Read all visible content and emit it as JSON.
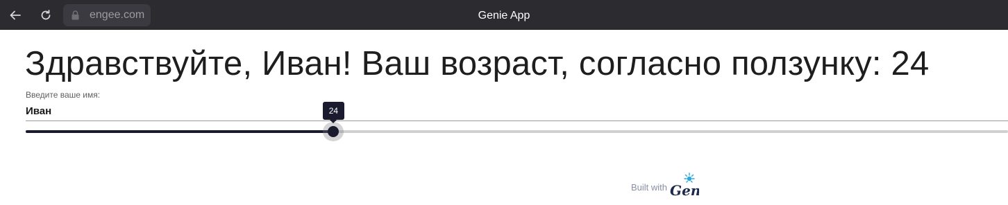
{
  "browser": {
    "url": "engee.com",
    "title": "Genie App",
    "icons": [
      "back-arrow-icon",
      "reload-icon",
      "lock-icon"
    ]
  },
  "main": {
    "heading": "Здравствуйте, Иван! Ваш возраст, согласно ползунку: 24",
    "name_label": "Введите ваше имя:",
    "name_value": "Иван"
  },
  "slider": {
    "value": 24,
    "fraction": 0.313,
    "tooltip": "24"
  },
  "footer": {
    "built_with": "Built with",
    "logo_text": "Genie"
  },
  "colors": {
    "accent": "#1b1b2f",
    "topbar": "#2b2b30",
    "track": "#d0d0d0"
  }
}
